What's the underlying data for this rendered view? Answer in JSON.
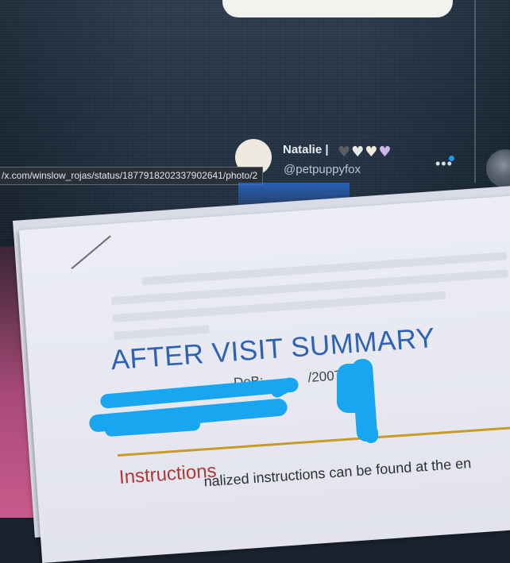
{
  "tweet": {
    "display_name": "Natalie |",
    "handle": "@petpuppyfox",
    "hearts": [
      {
        "glyph": "♥",
        "color": "#5e5e5e"
      },
      {
        "glyph": "♥",
        "color": "#e8e8ea"
      },
      {
        "glyph": "♥",
        "color": "#f1ecd8"
      },
      {
        "glyph": "♥",
        "color": "#c9b8ea"
      }
    ],
    "more_icon": "•••"
  },
  "browser": {
    "status_url": "/x.com/winslow_rojas/status/1877918202337902641/photo/2"
  },
  "document": {
    "title": "AFTER VISIT SUMMARY",
    "dob_label": "DoB:",
    "dob_year": "/2007",
    "section_heading": "Instructions",
    "section_text": "nalized instructions can be found at the en"
  },
  "colors": {
    "title_blue": "#2e63b4",
    "rule_gold": "#c79a2a",
    "heading_red": "#b03838",
    "redaction_blue": "#19a6f0"
  }
}
